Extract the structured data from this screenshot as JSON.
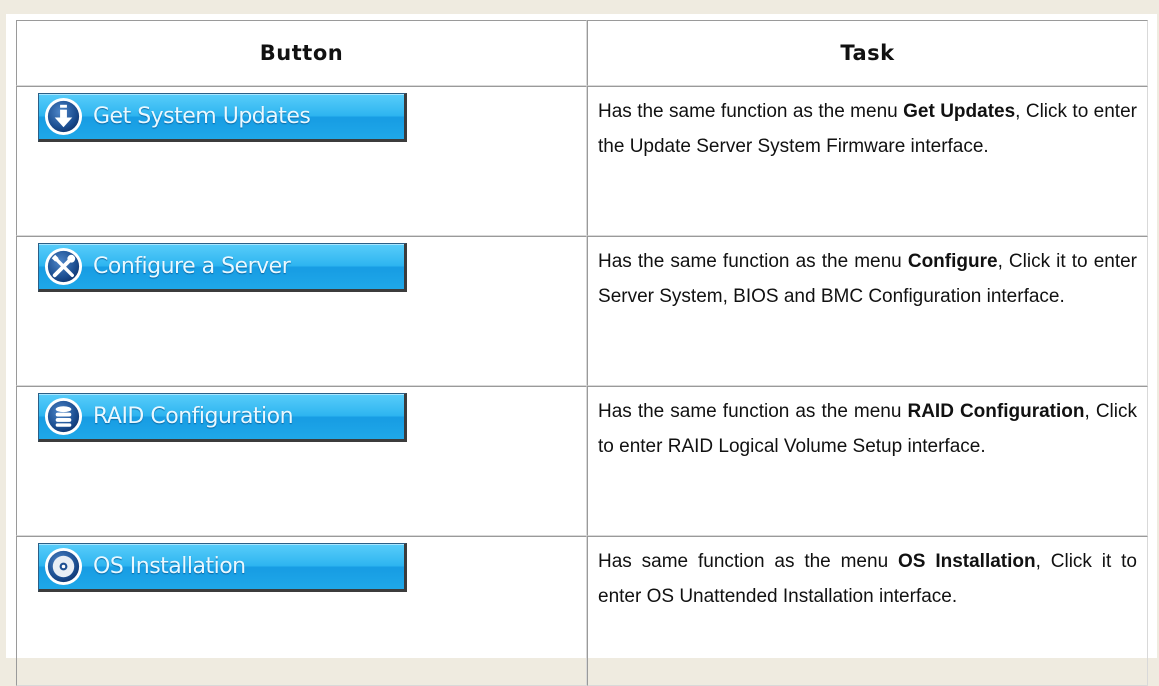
{
  "table": {
    "headers": {
      "button": "Button",
      "task": "Task"
    },
    "rows": [
      {
        "button_label": "Get System Updates",
        "icon": "download-icon",
        "task": {
          "pre": "Has the same function as the menu ",
          "bold": "Get Updates",
          "post": ", Click to enter the Update Server System Firmware interface."
        }
      },
      {
        "button_label": "Configure a Server",
        "icon": "wrench-screwdriver-icon",
        "task": {
          "pre": "Has the same function as the menu ",
          "bold": "Configure",
          "post": ", Click it to enter Server System, BIOS and BMC Configuration interface."
        }
      },
      {
        "button_label": "RAID Configuration",
        "icon": "database-icon",
        "task": {
          "pre": "Has the same function as the menu ",
          "bold": "RAID Configuration",
          "post": ", Click to enter RAID Logical Volume Setup interface."
        }
      },
      {
        "button_label": "OS Installation",
        "icon": "disc-icon",
        "task": {
          "pre": "Has same function as the menu ",
          "bold": "OS Installation",
          "post": ", Click it to enter OS Unattended Installation interface."
        }
      }
    ]
  }
}
